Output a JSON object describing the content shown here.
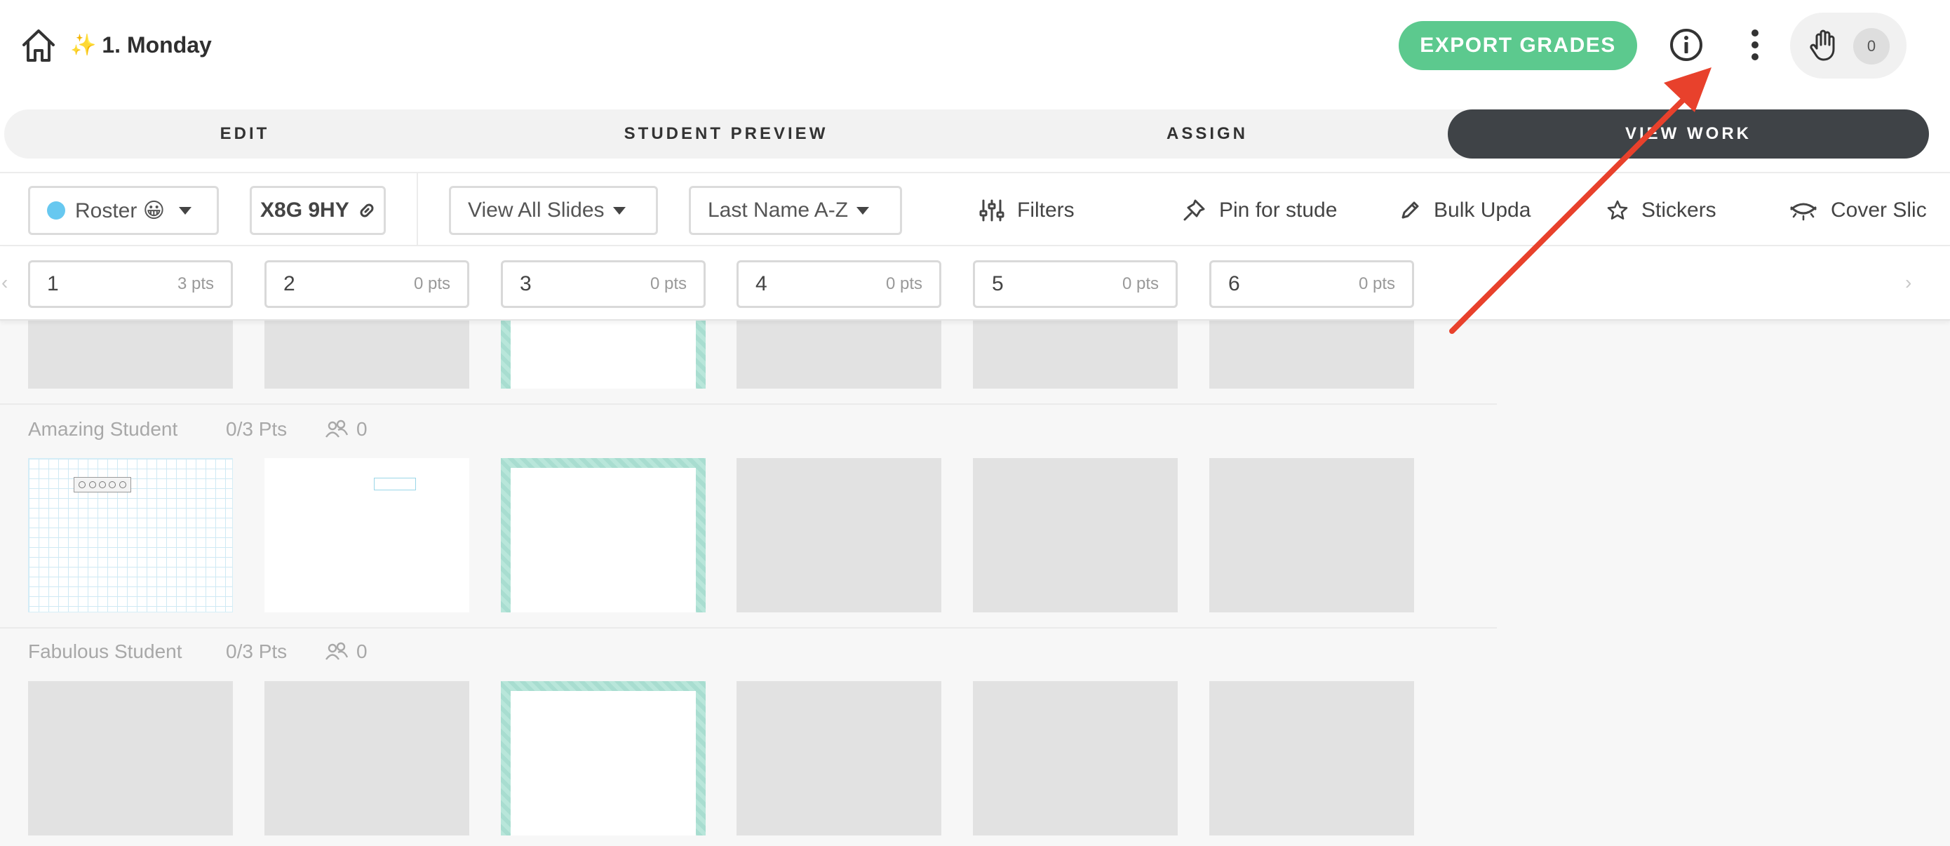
{
  "header": {
    "lesson_icon": "sparkles-icon",
    "lesson_title": "1. Monday",
    "export_label": "EXPORT GRADES",
    "raised_hands_count": "0"
  },
  "tabs": [
    {
      "label": "EDIT",
      "active": false
    },
    {
      "label": "STUDENT PREVIEW",
      "active": false
    },
    {
      "label": "ASSIGN",
      "active": false
    },
    {
      "label": "VIEW WORK",
      "active": true
    }
  ],
  "toolbar": {
    "roster_label": "Roster 😀",
    "class_code": "X8G 9HY",
    "slides_filter": "View All Slides",
    "sort_order": "Last Name A-Z",
    "filters_label": "Filters",
    "pin_label": "Pin for stude",
    "bulk_label": "Bulk Upda",
    "stickers_label": "Stickers",
    "cover_label": "Cover Slic"
  },
  "slides": [
    {
      "number": "1",
      "points": "3 pts"
    },
    {
      "number": "2",
      "points": "0 pts"
    },
    {
      "number": "3",
      "points": "0 pts"
    },
    {
      "number": "4",
      "points": "0 pts"
    },
    {
      "number": "5",
      "points": "0 pts"
    },
    {
      "number": "6",
      "points": "0 pts"
    }
  ],
  "students": [
    {
      "name": "Amazing Student",
      "points": "0/3 Pts",
      "group_count": "0"
    },
    {
      "name": "Fabulous Student",
      "points": "0/3 Pts",
      "group_count": "0"
    }
  ],
  "colors": {
    "export_button": "#5cc98e",
    "active_tab": "#3f4347",
    "roster_dot": "#67c8f0",
    "annotation_arrow": "#e8412c",
    "current_slide_border": "#a8ddd0"
  }
}
